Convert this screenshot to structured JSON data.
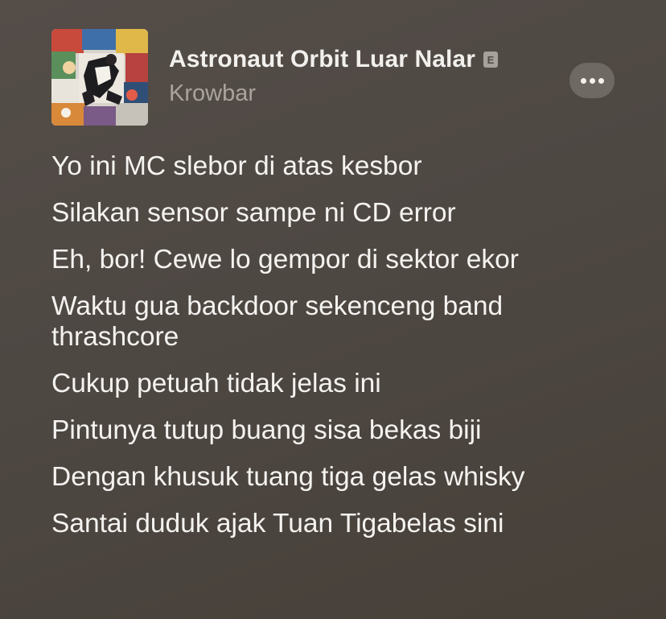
{
  "song": {
    "title": "Astronaut Orbit Luar Nalar",
    "explicit_badge": "E",
    "artist": "Krowbar"
  },
  "actions": {
    "more_icon": "ellipsis-icon"
  },
  "lyrics": [
    "Yo ini MC slebor di atas kesbor",
    "Silakan sensor sampe ni CD error",
    "Eh, bor! Cewe lo gempor di sektor ekor",
    [
      "Waktu gua backdoor sekenceng band",
      "thrashcore"
    ],
    "Cukup petuah tidak jelas ini",
    "Pintunya tutup buang sisa bekas biji",
    "Dengan khusuk tuang tiga gelas whisky",
    "Santai duduk ajak Tuan Tigabelas sini"
  ],
  "colors": {
    "background": "#4e4843",
    "text": "#f5f3f0",
    "secondary_text": "#aaa39c",
    "button": "#6f6963"
  }
}
